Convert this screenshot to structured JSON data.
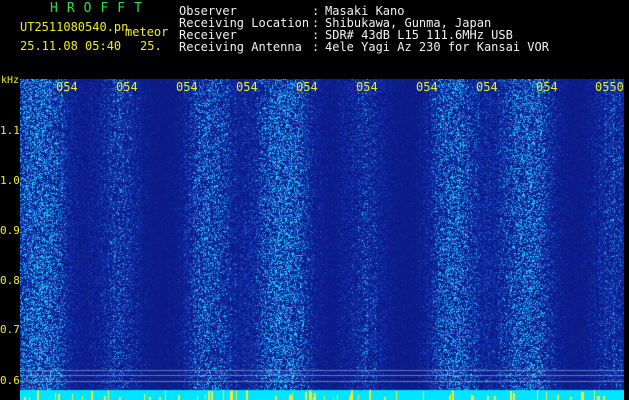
{
  "app": {
    "name": "HROFFT",
    "filename": "UT2511080540.pn",
    "suffix": "meteor",
    "datetime": "25.11.08 05:40",
    "seconds": "25."
  },
  "info": [
    {
      "label": "Observer",
      "value": "Masaki Kano"
    },
    {
      "label": "Receiving Location",
      "value": "Shibukawa, Gunma, Japan"
    },
    {
      "label": "Receiver",
      "value": "SDR# 43dB L15 111.6MHz USB"
    },
    {
      "label": "Receiving Antenna",
      "value": "4ele Yagi Az 230 for Kansai VOR"
    }
  ],
  "yaxis": {
    "unit": "kHz",
    "ticks": [
      "1.1",
      "1.0",
      "0.9",
      "0.8",
      "0.7",
      "0.6"
    ]
  },
  "xaxis": {
    "ticks": [
      "054",
      "054",
      "054",
      "054",
      "054",
      "054",
      "054",
      "054",
      "054",
      "0550"
    ]
  },
  "colors": {
    "background": "#000000",
    "spectrogram_base": "#0b1a85",
    "label_yellow": "#f2ec2a",
    "title_green": "#27e33a",
    "noise_floor_cyan": "#00e5ff"
  }
}
